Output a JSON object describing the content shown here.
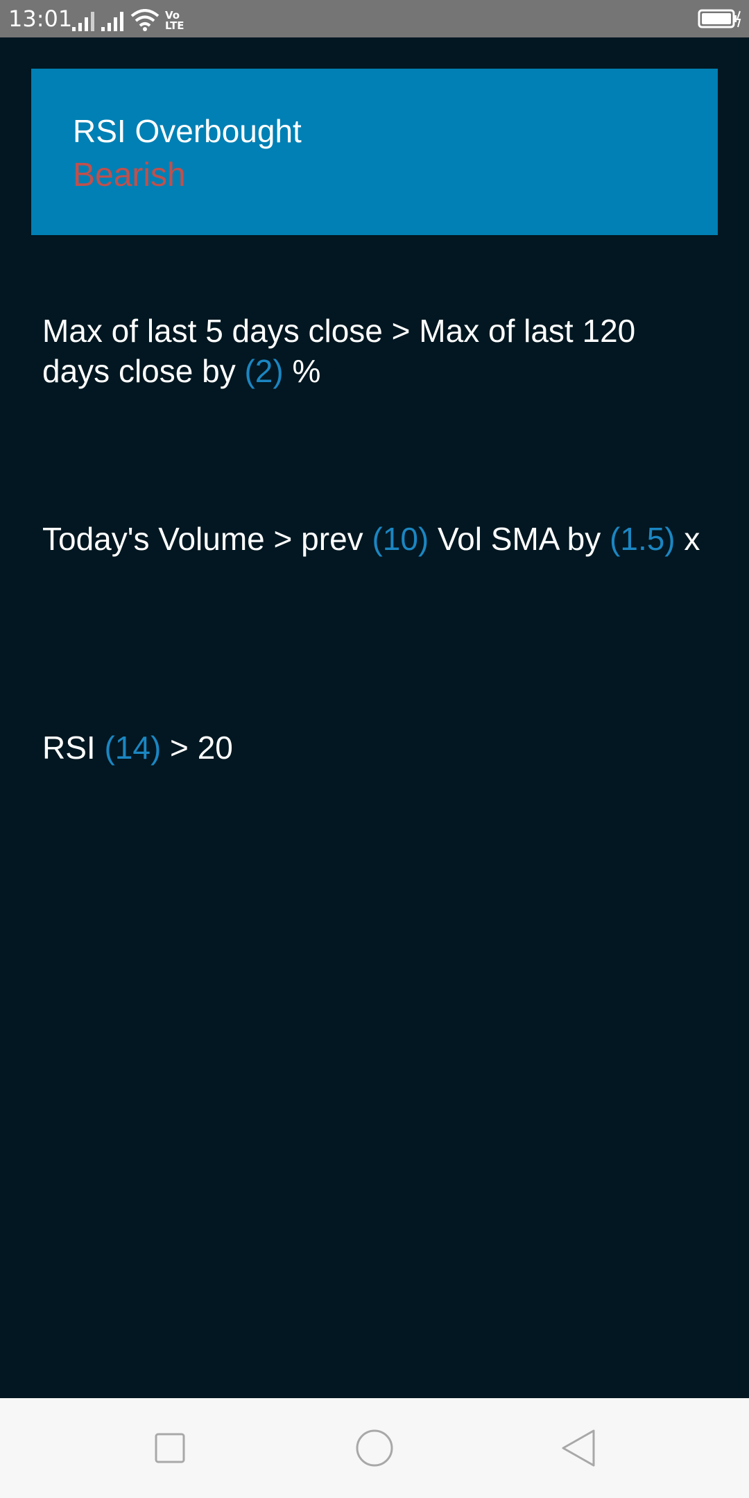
{
  "status_bar": {
    "time": "13:01",
    "network_label_top": "Vo",
    "network_label_bottom": "LTE",
    "icons": [
      "signal-icon",
      "signal-icon",
      "wifi-icon",
      "volte-icon",
      "battery-icon"
    ]
  },
  "header": {
    "title": "RSI Overbought",
    "subtitle": "Bearish"
  },
  "conditions": [
    {
      "p1": "Max of last 5 days close > Max of last 120 days close by ",
      "param1": "(2)",
      "p2": " %"
    },
    {
      "p1": "Today's Volume > prev ",
      "param1": "(10)",
      "p2": " Vol SMA by ",
      "param2": "(1.5)",
      "p3": " x"
    },
    {
      "p1": "RSI ",
      "param1": "(14)",
      "p2": " > 20"
    }
  ],
  "nav_bar": {
    "buttons": [
      "recent-apps-icon",
      "home-icon",
      "back-icon"
    ]
  },
  "colors": {
    "background": "#021721",
    "header_background": "#0080b4",
    "bearish": "#c0504d",
    "parameter": "#1b86c2",
    "status_bar": "#757575",
    "nav_bar": "#f7f7f7"
  }
}
